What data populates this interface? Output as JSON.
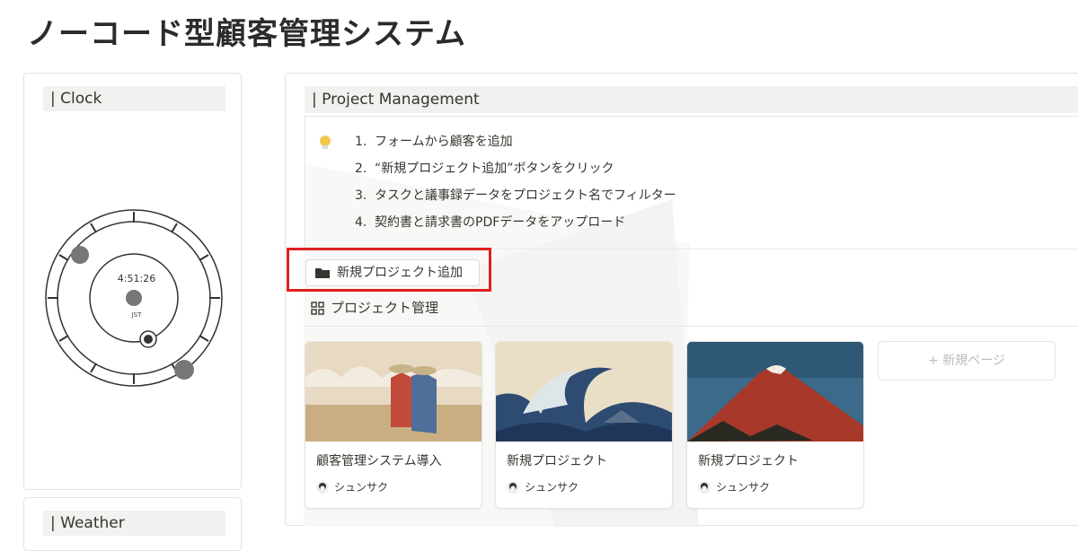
{
  "page": {
    "title": "ノーコード型顧客管理システム"
  },
  "clock": {
    "header": "Clock",
    "time": "4:51:26",
    "zone": "JST"
  },
  "weather": {
    "header": "Weather"
  },
  "project": {
    "header": "Project Management",
    "steps": [
      {
        "num": "1.",
        "text": "フォームから顧客を追加"
      },
      {
        "num": "2.",
        "text": "“新規プロジェクト追加”ボタンをクリック"
      },
      {
        "num": "3.",
        "text": "タスクと議事録データをプロジェクト名でフィルター"
      },
      {
        "num": "4.",
        "text": "契約書と請求書のPDFデータをアップロード"
      }
    ],
    "new_project_button": "新規プロジェクト追加",
    "view_label": "プロジェクト管理",
    "cards": [
      {
        "title": "顧客管理システム導入",
        "user": "シュンサク"
      },
      {
        "title": "新規プロジェクト",
        "user": "シュンサク"
      },
      {
        "title": "新規プロジェクト",
        "user": "シュンサク"
      }
    ],
    "new_page": "+ 新規ページ"
  },
  "colors": {
    "highlight": "#e02020",
    "accent_bulb": "#f2c94c",
    "panel_head_bg": "#f1f1ef"
  }
}
